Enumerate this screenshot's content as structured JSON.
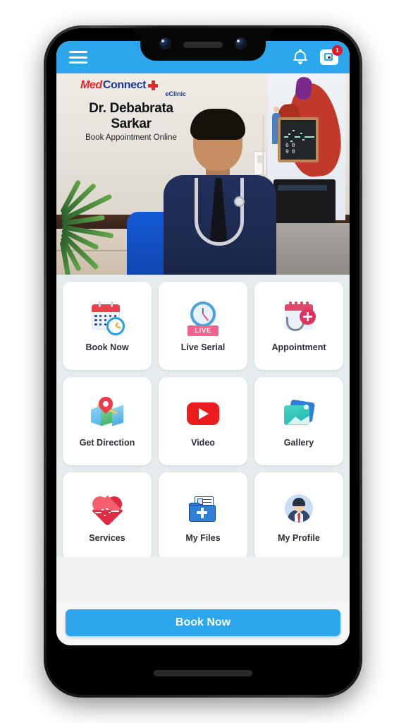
{
  "app": {
    "header": {
      "menu_icon": "hamburger-menu-icon",
      "notification_icon": "bell-icon",
      "wallet_icon": "card-icon",
      "badge_count": "1",
      "background_color": "#2ca7ee"
    },
    "banner": {
      "logo": {
        "part_med": "Med",
        "part_connect": "Connect",
        "cross_icon": "medical-cross-icon",
        "subtitle": "eClinic",
        "color_med": "#e8252a",
        "color_connect": "#1c3a94"
      },
      "doctor_name": "Dr. Debabrata Sarkar",
      "tagline": "Book Appointment Online",
      "photo_description": "doctor-portrait-photo"
    },
    "menu_grid": {
      "rows": [
        [
          {
            "label": "Book Now",
            "icon": "calendar-clock-icon"
          },
          {
            "label": "Live Serial",
            "icon": "live-clock-icon",
            "badge": "LIVE"
          },
          {
            "label": "Appointment",
            "icon": "calendar-stethoscope-icon"
          }
        ],
        [
          {
            "label": "Get Direction",
            "icon": "map-pin-icon"
          },
          {
            "label": "Video",
            "icon": "youtube-play-icon"
          },
          {
            "label": "Gallery",
            "icon": "photo-stack-icon"
          }
        ],
        [
          {
            "label": "Services",
            "icon": "heart-pulse-icon"
          },
          {
            "label": "My Files",
            "icon": "medical-folder-icon"
          },
          {
            "label": "My Profile",
            "icon": "user-avatar-icon"
          }
        ],
        [
          {
            "label": "",
            "icon": "feedback-faces-icon"
          },
          {
            "label": "",
            "icon": "bell-notification-icon"
          },
          {
            "label": "",
            "icon": "whatsapp-icon"
          }
        ]
      ]
    },
    "bottom_bar": {
      "cta_label": "Book Now",
      "cta_color": "#2ca7ee"
    },
    "background_color": "#e5ecee"
  }
}
